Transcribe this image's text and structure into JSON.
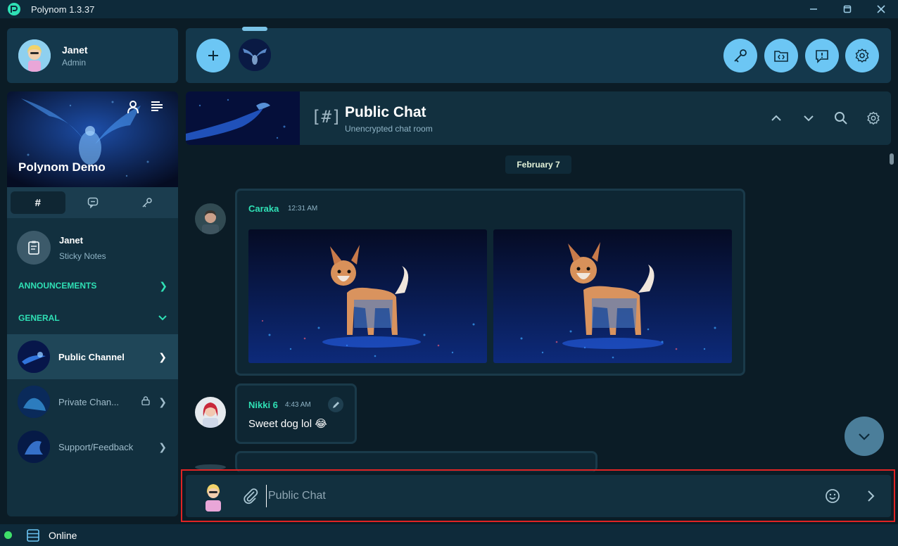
{
  "window": {
    "title": "Polynom 1.3.37"
  },
  "user": {
    "name": "Janet",
    "role": "Admin"
  },
  "server": {
    "name": "Polynom Demo"
  },
  "sidebar_tabs": [
    {
      "label": "#",
      "active": true
    },
    {
      "label": "",
      "icon": "chat-bubble-icon"
    },
    {
      "label": "",
      "icon": "key-icon"
    }
  ],
  "sticky": {
    "name": "Janet",
    "sub": "Sticky Notes"
  },
  "categories": [
    {
      "label": "ANNOUNCEMENTS",
      "state": "collapsed"
    },
    {
      "label": "GENERAL",
      "state": "expanded"
    }
  ],
  "channels": [
    {
      "label": "Public Channel",
      "active": true
    },
    {
      "label": "Private Chan...",
      "locked": true
    },
    {
      "label": "Support/Feedback"
    }
  ],
  "toolbar": {
    "buttons": [
      "add-server-icon",
      "key-icon",
      "code-folder-icon",
      "info-icon",
      "settings-icon"
    ]
  },
  "channel_header": {
    "title": "Public Chat",
    "subtitle": "Unencrypted chat room",
    "hash": "[#]"
  },
  "messages": {
    "date": "February 7",
    "items": [
      {
        "author": "Caraka",
        "time": "12:31 AM",
        "images": 2
      },
      {
        "author": "Nikki 6",
        "time": "4:43 AM",
        "text": "Sweet dog lol 😂"
      }
    ]
  },
  "composer": {
    "placeholder": "Public Chat",
    "value": ""
  },
  "status": {
    "text": "Online",
    "color": "#3fe06a"
  },
  "colors": {
    "accent": "#6cc6f4",
    "author": "#2fe0b5",
    "panel": "#12303f"
  }
}
